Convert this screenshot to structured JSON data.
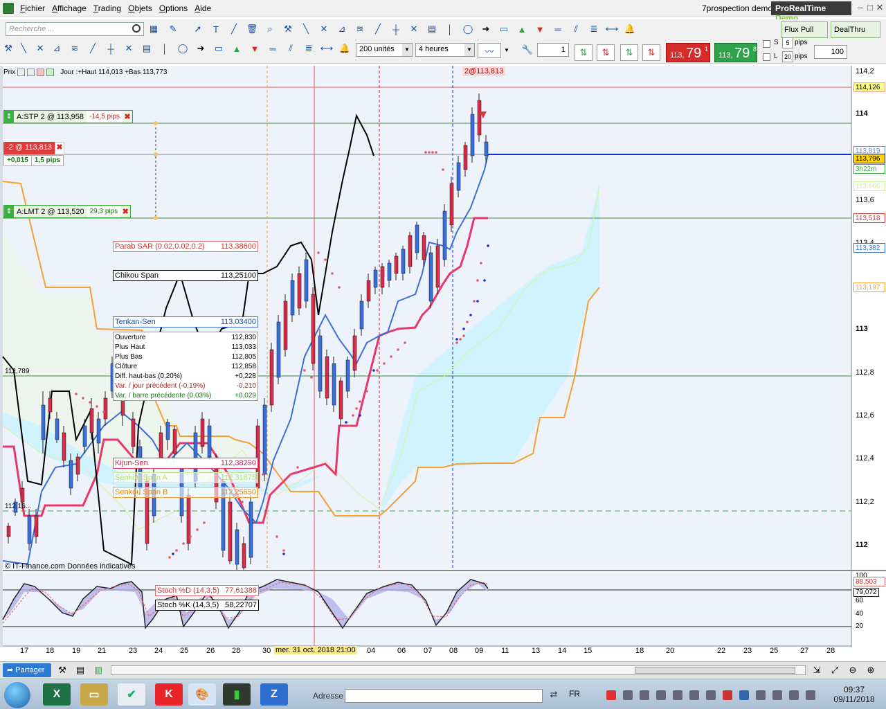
{
  "menu": [
    "Fichier",
    "Affichage",
    "Trading",
    "Objets",
    "Options",
    "Aide"
  ],
  "account": "7prospection demo",
  "brand": {
    "name": "ProRealTime",
    "suffix": "Demo"
  },
  "search": {
    "placeholder": "Recherche ..."
  },
  "toolbar": {
    "flux": "Flux Pull",
    "dealthru": "DealThru",
    "units": "200 unités",
    "timeframe": "4 heures",
    "quantity": "1",
    "sell": {
      "small": "113,",
      "big": "79",
      "sup": "1"
    },
    "buy": {
      "small": "113,",
      "big": "79",
      "sup": "8"
    },
    "stop_label": "S",
    "stop_pips": "5",
    "limit_label": "L",
    "limit_pips": "20",
    "pips_word": "pips",
    "leverage": "100"
  },
  "chart_header": {
    "instrument": "Prix",
    "text": "Jour :+Haut 114,013 +Bas 113,773"
  },
  "orders": {
    "stop": {
      "label": "A:STP 2 @ 113,958",
      "pips": "-14,5 pips"
    },
    "limit": {
      "label": "A:LMT 2 @ 113,520",
      "pips": "29,3 pips"
    },
    "position": {
      "label": "-2 @ 113,813",
      "pnl": "+0,015",
      "pips": "1,5 pips"
    },
    "top_tag": "2@113,813"
  },
  "indicators": {
    "parab": {
      "name": "Parab SAR (0.02,0.02,0.2)",
      "value": "113,38600"
    },
    "chikou": {
      "name": "Chikou Span",
      "value": "113,25100"
    },
    "tenkan": {
      "name": "Tenkan-Sen",
      "value": "113,03400"
    },
    "kijun": {
      "name": "Kijun-Sen",
      "value": "112,38250"
    },
    "senkou_a": {
      "name": "Senkou Span A",
      "value": "112,31875"
    },
    "senkou_b": {
      "name": "Senkou Span B",
      "value": "112,25650"
    }
  },
  "ohlc": [
    {
      "label": "Ouverture",
      "value": "112,830"
    },
    {
      "label": "Plus Haut",
      "value": "113,033"
    },
    {
      "label": "Plus Bas",
      "value": "112,805"
    },
    {
      "label": "Clôture",
      "value": "112,858"
    },
    {
      "label": "Diff. haut-bas (0,20%)",
      "value": "+0,228"
    },
    {
      "label": "Var. / jour précédent (-0,19%)",
      "value": "-0,210",
      "color": "#b22222"
    },
    {
      "label": "Var. / barre précédente (0,03%)",
      "value": "+0,029",
      "color": "#137a13"
    }
  ],
  "price_axis": [
    "114,2",
    "114",
    "113,8",
    "113,6",
    "113,4",
    "113,2",
    "113",
    "112,8",
    "112,6",
    "112,4",
    "112,2",
    "112"
  ],
  "price_tags": [
    {
      "value": "114,126",
      "color": "#e8a0a0",
      "bg": "#ffff88"
    },
    {
      "value": "113,819",
      "color": "#6a8fd8",
      "bg": "#ffffff"
    },
    {
      "value": "113,796",
      "color": "#222222",
      "bg": "#ffd400"
    },
    {
      "value": "3h22m",
      "color": "#3cb043",
      "bg": "#ffffff"
    },
    {
      "value": "113,666",
      "color": "#c8f09a",
      "bg": "#ffffff"
    },
    {
      "value": "113,518",
      "color": "#e03b3b",
      "bg": "#ffffff"
    },
    {
      "value": "113,382",
      "color": "#3a6fd8",
      "bg": "#ffffff"
    },
    {
      "value": "113,197",
      "color": "#f5a032",
      "bg": "#ffffff"
    }
  ],
  "left_labels": {
    "upper": "112,789",
    "lower": "112,16..."
  },
  "watermark": "© IT-Finance.com  Données indicatives",
  "stoch": {
    "d": {
      "name": "Stoch %D (14,3,5)",
      "value": "77,61388"
    },
    "k": {
      "name": "Stoch %K (14,3,5)",
      "value": "58,22707"
    },
    "axis": [
      "100",
      "79,072",
      "60",
      "40",
      "20"
    ],
    "tag": "88,503"
  },
  "x_axis": [
    "17",
    "18",
    "19",
    "21",
    "23",
    "24",
    "25",
    "26",
    "28",
    "30",
    "04",
    "06",
    "07",
    "08",
    "09",
    "11",
    "13",
    "14",
    "15",
    "18",
    "20",
    "22",
    "23",
    "25",
    "27",
    "28"
  ],
  "x_highlight": "mer. 31 oct. 2018 21:00",
  "share": "Partager",
  "taskbar": {
    "address_label": "Adresse",
    "lang": "FR",
    "time": "09:37",
    "date": "09/11/2018"
  },
  "colors": {
    "sell": "#d62b2b",
    "buy": "#2ea34a",
    "tenkan": "#3a6fd8",
    "kijun": "#e8386a",
    "senkou_b": "#f5a032",
    "senkou_a": "#d4f59a",
    "chikou": "#000000",
    "cloud_bull": "#cdf3ff",
    "cloud_bear": "#f1f5ec"
  }
}
